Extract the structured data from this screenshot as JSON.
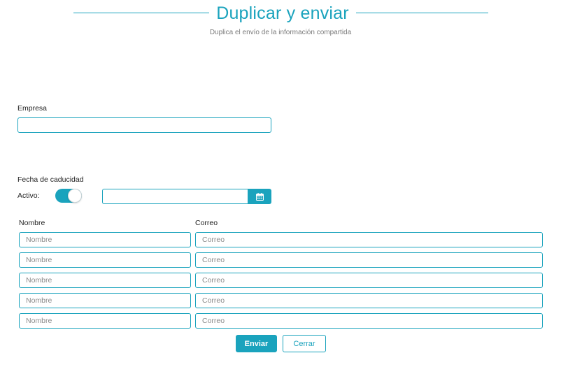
{
  "header": {
    "title": "Duplicar y enviar",
    "subtitle": "Duplica el envío de la información compartida"
  },
  "empresa": {
    "label": "Empresa",
    "value": ""
  },
  "expiry": {
    "label": "Fecha de caducidad",
    "active_label": "Activo:",
    "active": true,
    "date_value": ""
  },
  "recipients": {
    "name_header": "Nombre",
    "email_header": "Correo",
    "rows": [
      {
        "name_placeholder": "Nombre",
        "email_placeholder": "Correo"
      },
      {
        "name_placeholder": "Nombre",
        "email_placeholder": "Correo"
      },
      {
        "name_placeholder": "Nombre",
        "email_placeholder": "Correo"
      },
      {
        "name_placeholder": "Nombre",
        "email_placeholder": "Correo"
      },
      {
        "name_placeholder": "Nombre",
        "email_placeholder": "Correo"
      }
    ]
  },
  "actions": {
    "send_label": "Enviar",
    "close_label": "Cerrar"
  },
  "colors": {
    "accent": "#1aa3bd"
  },
  "icons": {
    "date_picker": "calendar-icon"
  }
}
